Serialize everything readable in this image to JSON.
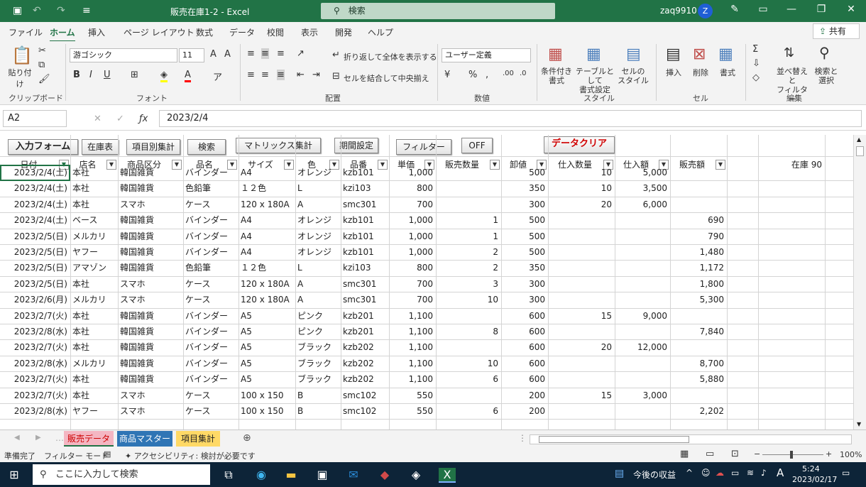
{
  "titlebar": {
    "title": "販売在庫1-2  -  Excel",
    "search_placeholder": "検索",
    "user": "zaq9910",
    "avatar_initial": "Z"
  },
  "menu": {
    "items": [
      "ファイル",
      "ホーム",
      "挿入",
      "ページ レイアウト",
      "数式",
      "データ",
      "校閲",
      "表示",
      "開発",
      "ヘルプ"
    ],
    "active": "ホーム",
    "share": "共有"
  },
  "ribbon": {
    "clipboard": {
      "paste": "貼り付け",
      "label": "クリップボード"
    },
    "font": {
      "name": "游ゴシック",
      "size": "11",
      "label": "フォント",
      "bold": "B",
      "italic": "I",
      "underline": "U"
    },
    "alignment": {
      "wrap": "折り返して全体を表示する",
      "merge": "セルを結合して中央揃え",
      "label": "配置"
    },
    "number": {
      "format": "ユーザー定義",
      "label": "数値"
    },
    "styles": {
      "conditional": "条件付き\n書式",
      "table": "テーブルとして\n書式設定",
      "cell": "セルの\nスタイル",
      "label": "スタイル"
    },
    "cells": {
      "insert": "挿入",
      "delete": "削除",
      "format": "書式",
      "label": "セル"
    },
    "editing": {
      "sort": "並べ替えと\nフィルター",
      "find": "検索と\n選択",
      "label": "編集"
    }
  },
  "formula": {
    "cell_ref": "A2",
    "value": "2023/2/4"
  },
  "sheet_buttons": {
    "input_form": "入力フォーム",
    "stock": "在庫表",
    "item_summary": "項目別集計",
    "search": "検索",
    "matrix": "マトリックス集計",
    "period": "期間設定",
    "filter": "フィルター",
    "off": "OFF",
    "clear": "データクリア"
  },
  "columns": [
    "日付",
    "店名",
    "商品区分",
    "品名",
    "サイズ",
    "色",
    "品番",
    "単価",
    "販売数量",
    "卸値",
    "仕入数量",
    "仕入額",
    "販売額"
  ],
  "stock_label": "在庫 90",
  "rows": [
    [
      "2023/2/4(土)",
      "本社",
      "韓国雑貨",
      "バインダー",
      "A4",
      "オレンジ",
      "kzb101",
      "1,000",
      "",
      "500",
      "10",
      "5,000",
      ""
    ],
    [
      "2023/2/4(土)",
      "本社",
      "韓国雑貨",
      "色鉛筆",
      "１２色",
      "L",
      "kzi103",
      "800",
      "",
      "350",
      "10",
      "3,500",
      ""
    ],
    [
      "2023/2/4(土)",
      "本社",
      "スマホ",
      "ケース",
      "120 x 180A",
      "A",
      "smc301",
      "700",
      "",
      "300",
      "20",
      "6,000",
      ""
    ],
    [
      "2023/2/4(土)",
      "ベース",
      "韓国雑貨",
      "バインダー",
      "A4",
      "オレンジ",
      "kzb101",
      "1,000",
      "1",
      "500",
      "",
      "",
      "690"
    ],
    [
      "2023/2/5(日)",
      "メルカリ",
      "韓国雑貨",
      "バインダー",
      "A4",
      "オレンジ",
      "kzb101",
      "1,000",
      "1",
      "500",
      "",
      "",
      "790"
    ],
    [
      "2023/2/5(日)",
      "ヤフー",
      "韓国雑貨",
      "バインダー",
      "A4",
      "オレンジ",
      "kzb101",
      "1,000",
      "2",
      "500",
      "",
      "",
      "1,480"
    ],
    [
      "2023/2/5(日)",
      "アマゾン",
      "韓国雑貨",
      "色鉛筆",
      "１２色",
      "L",
      "kzi103",
      "800",
      "2",
      "350",
      "",
      "",
      "1,172"
    ],
    [
      "2023/2/5(日)",
      "本社",
      "スマホ",
      "ケース",
      "120 x 180A",
      "A",
      "smc301",
      "700",
      "3",
      "300",
      "",
      "",
      "1,800"
    ],
    [
      "2023/2/6(月)",
      "メルカリ",
      "スマホ",
      "ケース",
      "120 x 180A",
      "A",
      "smc301",
      "700",
      "10",
      "300",
      "",
      "",
      "5,300"
    ],
    [
      "2023/2/7(火)",
      "本社",
      "韓国雑貨",
      "バインダー",
      "A5",
      "ピンク",
      "kzb201",
      "1,100",
      "",
      "600",
      "15",
      "9,000",
      ""
    ],
    [
      "2023/2/8(水)",
      "本社",
      "韓国雑貨",
      "バインダー",
      "A5",
      "ピンク",
      "kzb201",
      "1,100",
      "8",
      "600",
      "",
      "",
      "7,840"
    ],
    [
      "2023/2/7(火)",
      "本社",
      "韓国雑貨",
      "バインダー",
      "A5",
      "ブラック",
      "kzb202",
      "1,100",
      "",
      "600",
      "20",
      "12,000",
      ""
    ],
    [
      "2023/2/8(水)",
      "メルカリ",
      "韓国雑貨",
      "バインダー",
      "A5",
      "ブラック",
      "kzb202",
      "1,100",
      "10",
      "600",
      "",
      "",
      "8,700"
    ],
    [
      "2023/2/7(火)",
      "本社",
      "韓国雑貨",
      "バインダー",
      "A5",
      "ブラック",
      "kzb202",
      "1,100",
      "6",
      "600",
      "",
      "",
      "5,880"
    ],
    [
      "2023/2/7(火)",
      "本社",
      "スマホ",
      "ケース",
      "100 x 150",
      "B",
      "smc102",
      "550",
      "",
      "200",
      "15",
      "3,000",
      ""
    ],
    [
      "2023/2/8(水)",
      "ヤフー",
      "スマホ",
      "ケース",
      "100 x 150",
      "B",
      "smc102",
      "550",
      "6",
      "200",
      "",
      "",
      "2,202"
    ]
  ],
  "tabs": [
    "販売データ",
    "商品マスター",
    "項目集計"
  ],
  "status": {
    "ready": "準備完了",
    "filter_mode": "フィルター モード",
    "accessibility": "アクセシビリティ: 検討が必要です",
    "zoom": "100%"
  },
  "taskbar": {
    "search_placeholder": "ここに入力して検索",
    "news": "今後の収益",
    "time": "5:24",
    "date": "2023/02/17",
    "ime": "A"
  },
  "colors": {
    "excel_green": "#217346",
    "tab_sales": "#f4b6c2",
    "tab_master": "#2f75b5",
    "tab_summary": "#ffd966",
    "clear_red": "#d00000"
  }
}
